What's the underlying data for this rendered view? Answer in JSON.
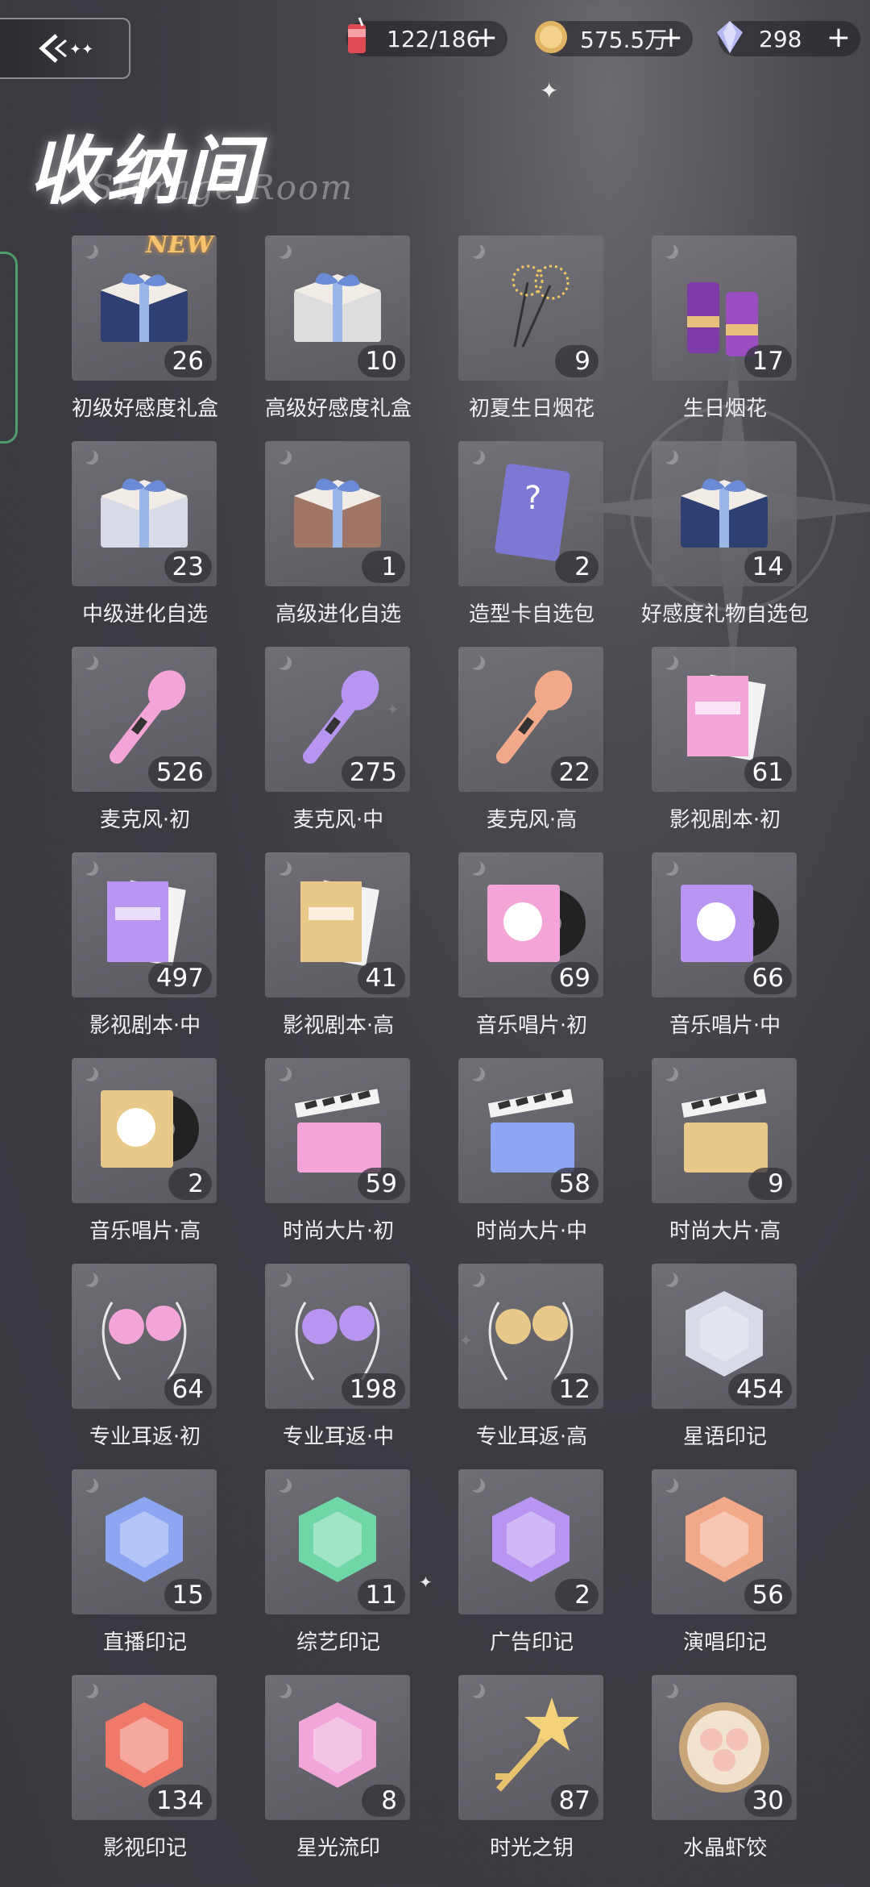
{
  "header": {
    "title": "收纳间",
    "subtitle": "Storage Room",
    "resources": [
      {
        "icon": "energy-drink-icon",
        "value": "122/186",
        "plus": "+"
      },
      {
        "icon": "gold-coin-icon",
        "value": "575.5万",
        "plus": "+"
      },
      {
        "icon": "diamond-icon",
        "value": "298",
        "plus": "+"
      }
    ]
  },
  "items": [
    {
      "name": "初级好感度礼盒",
      "count": "26",
      "icon": "gift-box-navy-icon",
      "badge": "NEW"
    },
    {
      "name": "高级好感度礼盒",
      "count": "10",
      "icon": "gift-set-luxury-icon"
    },
    {
      "name": "初夏生日烟花",
      "count": "9",
      "icon": "sparkler-icon"
    },
    {
      "name": "生日烟花",
      "count": "17",
      "icon": "firework-tubes-icon"
    },
    {
      "name": "中级进化自选",
      "count": "23",
      "icon": "gift-box-silver-icon"
    },
    {
      "name": "高级进化自选",
      "count": "1",
      "icon": "gift-box-bronze-icon"
    },
    {
      "name": "造型卡自选包",
      "count": "2",
      "icon": "style-card-icon"
    },
    {
      "name": "好感度礼物自选包",
      "count": "14",
      "icon": "gift-box-navy-icon"
    },
    {
      "name": "麦克风·初",
      "count": "526",
      "icon": "microphone-pink-icon"
    },
    {
      "name": "麦克风·中",
      "count": "275",
      "icon": "microphone-purple-icon"
    },
    {
      "name": "麦克风·高",
      "count": "22",
      "icon": "microphone-orange-icon"
    },
    {
      "name": "影视剧本·初",
      "count": "61",
      "icon": "script-pink-icon"
    },
    {
      "name": "影视剧本·中",
      "count": "497",
      "icon": "script-purple-icon"
    },
    {
      "name": "影视剧本·高",
      "count": "41",
      "icon": "script-gold-icon"
    },
    {
      "name": "音乐唱片·初",
      "count": "69",
      "icon": "record-pink-icon"
    },
    {
      "name": "音乐唱片·中",
      "count": "66",
      "icon": "record-purple-icon"
    },
    {
      "name": "音乐唱片·高",
      "count": "2",
      "icon": "record-gold-icon"
    },
    {
      "name": "时尚大片·初",
      "count": "59",
      "icon": "clapperboard-pink-icon"
    },
    {
      "name": "时尚大片·中",
      "count": "58",
      "icon": "clapperboard-blue-icon"
    },
    {
      "name": "时尚大片·高",
      "count": "9",
      "icon": "clapperboard-gold-icon"
    },
    {
      "name": "专业耳返·初",
      "count": "64",
      "icon": "earphones-pink-icon"
    },
    {
      "name": "专业耳返·中",
      "count": "198",
      "icon": "earphones-purple-icon"
    },
    {
      "name": "专业耳返·高",
      "count": "12",
      "icon": "earphones-gold-icon"
    },
    {
      "name": "星语印记",
      "count": "454",
      "icon": "crystal-silver-icon"
    },
    {
      "name": "直播印记",
      "count": "15",
      "icon": "crystal-blue-mic-icon"
    },
    {
      "name": "综艺印记",
      "count": "11",
      "icon": "crystal-green-smile-icon"
    },
    {
      "name": "广告印记",
      "count": "2",
      "icon": "crystal-purple-icon"
    },
    {
      "name": "演唱印记",
      "count": "56",
      "icon": "crystal-orange-mic-icon"
    },
    {
      "name": "影视印记",
      "count": "134",
      "icon": "crystal-red-film-icon"
    },
    {
      "name": "星光流印",
      "count": "8",
      "icon": "crystal-rainbow-icon"
    },
    {
      "name": "时光之钥",
      "count": "87",
      "icon": "star-key-icon"
    },
    {
      "name": "水晶虾饺",
      "count": "30",
      "icon": "dumpling-steamer-icon"
    }
  ]
}
